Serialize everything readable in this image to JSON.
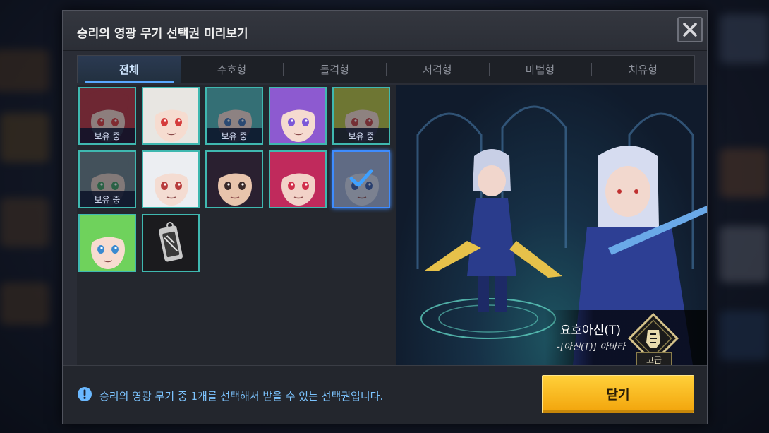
{
  "dialog": {
    "title": "승리의 영광 무기 선택권 미리보기"
  },
  "tabs": [
    {
      "label": "전체",
      "active": true
    },
    {
      "label": "수호형",
      "active": false
    },
    {
      "label": "돌격형",
      "active": false
    },
    {
      "label": "저격형",
      "active": false
    },
    {
      "label": "마법형",
      "active": false
    },
    {
      "label": "치유형",
      "active": false
    }
  ],
  "owned_label": "보유 중",
  "characters": [
    {
      "id": 1,
      "hair": "#b8323c",
      "skin": "#f1cfc4",
      "eye": "#d93a3a",
      "owned": true,
      "selected": false,
      "dim": true
    },
    {
      "id": 2,
      "hair": "#e8e6e2",
      "skin": "#f6dcd0",
      "eye": "#d53c3c",
      "owned": false,
      "selected": false,
      "dim": false
    },
    {
      "id": 3,
      "hair": "#4fb4b4",
      "skin": "#f1d7cc",
      "eye": "#3c6fb0",
      "owned": true,
      "selected": false,
      "dim": true
    },
    {
      "id": 4,
      "hair": "#8d5ad0",
      "skin": "#f5dbd0",
      "eye": "#7b58d8",
      "owned": false,
      "selected": false,
      "dim": false
    },
    {
      "id": 5,
      "hair": "#b8c23c",
      "skin": "#f3d8c8",
      "eye": "#c44040",
      "owned": true,
      "selected": false,
      "dim": true
    },
    {
      "id": 6,
      "hair": "#6b7e86",
      "skin": "#dcc6bb",
      "eye": "#3f9c5d",
      "owned": true,
      "selected": false,
      "dim": true
    },
    {
      "id": 7,
      "hair": "#eceef2",
      "skin": "#f4dcd2",
      "eye": "#b83c3c",
      "owned": false,
      "selected": false,
      "dim": false
    },
    {
      "id": 8,
      "hair": "#2a2030",
      "skin": "#e8c4ac",
      "eye": "#3a2a2a",
      "owned": false,
      "selected": false,
      "dim": false
    },
    {
      "id": 9,
      "hair": "#c02a5c",
      "skin": "#f2d2c8",
      "eye": "#d12f4c",
      "owned": false,
      "selected": false,
      "dim": false
    },
    {
      "id": 10,
      "hair": "#9eaed0",
      "skin": "#cfd6e6",
      "eye": "#3a5ca8",
      "owned": false,
      "selected": true,
      "dim": true
    },
    {
      "id": 11,
      "hair": "#6fd25c",
      "skin": "#f7dcd0",
      "eye": "#3a8ad0",
      "owned": false,
      "selected": false,
      "dim": false
    },
    {
      "id": 12,
      "hair": "#1a1a1a",
      "skin": "#2a2a2a",
      "eye": "#ffffff",
      "owned": false,
      "selected": false,
      "dim": false,
      "item": true
    }
  ],
  "preview": {
    "name": "요호아신(T)",
    "subtitle": "-[아신(T)] 아바타",
    "grade": "고급"
  },
  "footer": {
    "notice": "승리의 영광 무기 중 1개를 선택해서 받을 수 있는 선택권입니다.",
    "close_label": "닫기"
  },
  "colors": {
    "accent_button": "#f2a40b",
    "cell_border": "#3fb8b0",
    "selected_border": "#3e8cff",
    "notice_text": "#7cc4ff"
  }
}
